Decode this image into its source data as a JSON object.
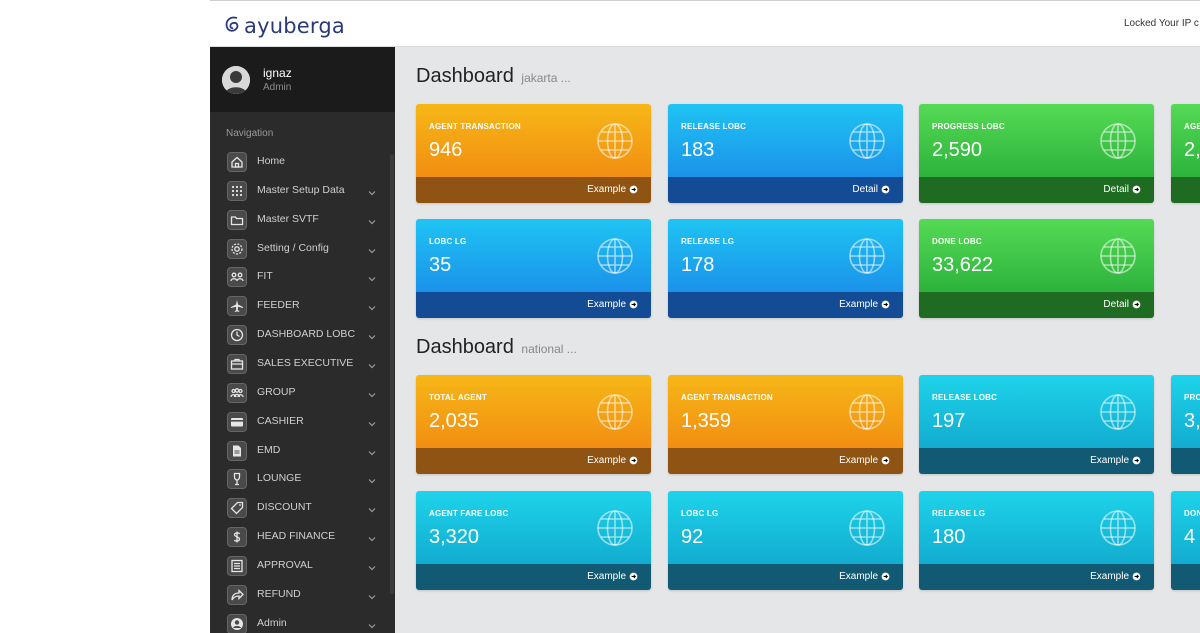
{
  "brand": {
    "name": "ayuberga"
  },
  "topbar": {
    "status_text": "Locked Your IP c"
  },
  "user": {
    "name": "ignaz",
    "role": "Admin"
  },
  "sidebar": {
    "nav_title": "Navigation",
    "items": [
      {
        "label": "Home",
        "icon": "home-icon",
        "has_caret": false
      },
      {
        "label": "Master Setup Data",
        "icon": "grid-icon",
        "has_caret": true
      },
      {
        "label": "Master SVTF",
        "icon": "folder-icon",
        "has_caret": true
      },
      {
        "label": "Setting / Config",
        "icon": "gear-icon",
        "has_caret": true
      },
      {
        "label": "FIT",
        "icon": "people-icon",
        "has_caret": true
      },
      {
        "label": "FEEDER",
        "icon": "airplane-icon",
        "has_caret": true
      },
      {
        "label": "DASHBOARD LOBC",
        "icon": "clock-icon",
        "has_caret": true
      },
      {
        "label": "SALES EXECUTIVE",
        "icon": "briefcase-icon",
        "has_caret": true
      },
      {
        "label": "GROUP",
        "icon": "group-icon",
        "has_caret": true
      },
      {
        "label": "CASHIER",
        "icon": "credit-card-icon",
        "has_caret": true
      },
      {
        "label": "EMD",
        "icon": "document-icon",
        "has_caret": true
      },
      {
        "label": "LOUNGE",
        "icon": "wine-glass-icon",
        "has_caret": true
      },
      {
        "label": "DISCOUNT",
        "icon": "tag-icon",
        "has_caret": true
      },
      {
        "label": "HEAD FINANCE",
        "icon": "dollar-icon",
        "has_caret": true
      },
      {
        "label": "APPROVAL",
        "icon": "list-icon",
        "has_caret": true
      },
      {
        "label": "REFUND",
        "icon": "share-icon",
        "has_caret": true
      },
      {
        "label": "Admin",
        "icon": "user-circle-icon",
        "has_caret": true
      }
    ]
  },
  "sections": [
    {
      "title": "Dashboard",
      "subtitle": "jakarta ...",
      "cards": [
        {
          "label": "AGENT TRANSACTION",
          "value": "946",
          "link": "Example",
          "color": "orange"
        },
        {
          "label": "RELEASE LOBC",
          "value": "183",
          "link": "Detail",
          "color": "blue"
        },
        {
          "label": "PROGRESS LOBC",
          "value": "2,590",
          "link": "Detail",
          "color": "green"
        },
        {
          "label": "AGE",
          "value": "2,",
          "link": "",
          "color": "green"
        },
        {
          "label": "LOBC LG",
          "value": "35",
          "link": "Example",
          "color": "blue"
        },
        {
          "label": "RELEASE LG",
          "value": "178",
          "link": "Example",
          "color": "blue"
        },
        {
          "label": "DONE LOBC",
          "value": "33,622",
          "link": "Detail",
          "color": "green"
        }
      ]
    },
    {
      "title": "Dashboard",
      "subtitle": "national ...",
      "cards": [
        {
          "label": "TOTAL AGENT",
          "value": "2,035",
          "link": "Example",
          "color": "orange"
        },
        {
          "label": "AGENT TRANSACTION",
          "value": "1,359",
          "link": "Example",
          "color": "orange"
        },
        {
          "label": "RELEASE LOBC",
          "value": "197",
          "link": "Example",
          "color": "cyan"
        },
        {
          "label": "PRO",
          "value": "3,",
          "link": "",
          "color": "cyan"
        },
        {
          "label": "AGENT FARE LOBC",
          "value": "3,320",
          "link": "Example",
          "color": "cyan"
        },
        {
          "label": "LOBC LG",
          "value": "92",
          "link": "Example",
          "color": "cyan"
        },
        {
          "label": "RELEASE LG",
          "value": "180",
          "link": "Example",
          "color": "cyan"
        },
        {
          "label": "DON",
          "value": "4",
          "link": "",
          "color": "cyan"
        }
      ]
    }
  ]
}
